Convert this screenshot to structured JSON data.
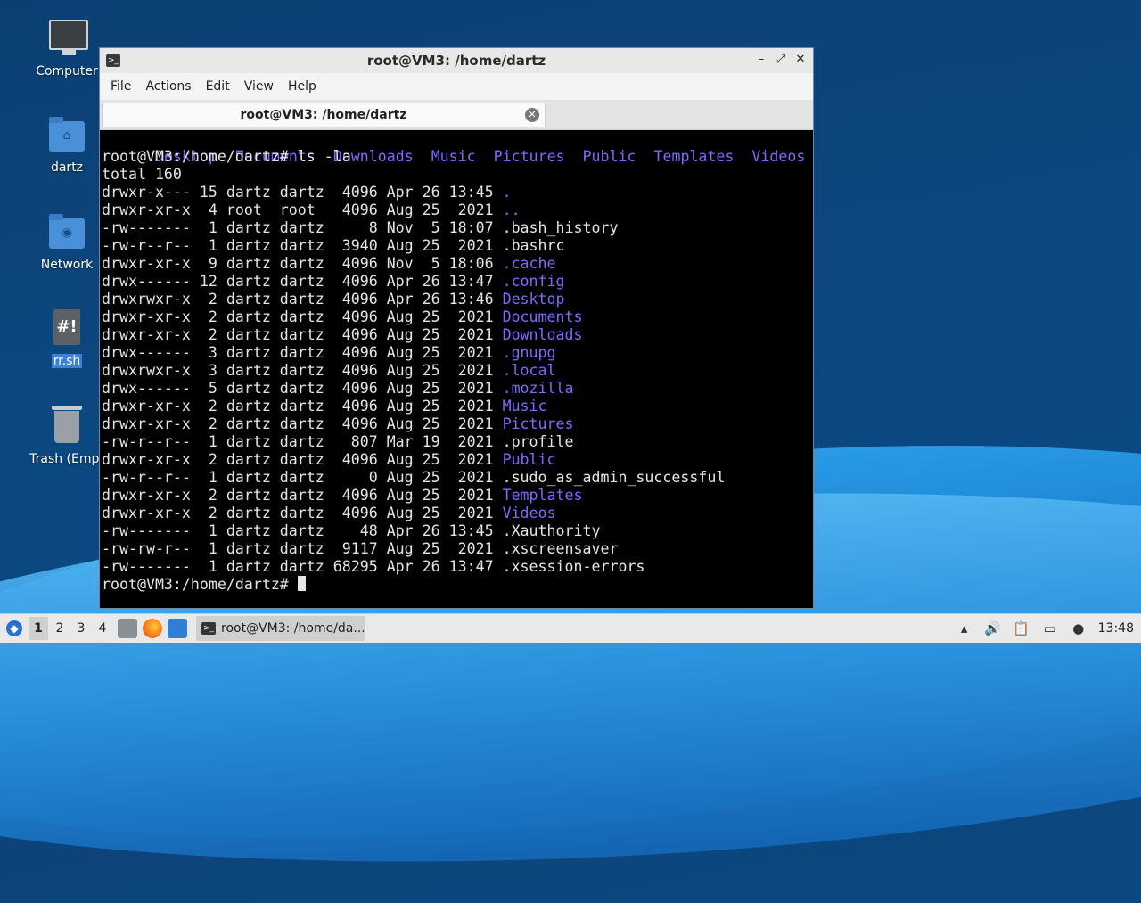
{
  "desktop": {
    "icons": [
      {
        "label": "Computer",
        "icon": "computer-icon"
      },
      {
        "label": "dartz",
        "icon": "home-folder-icon"
      },
      {
        "label": "Network",
        "icon": "network-folder-icon"
      },
      {
        "label": "rr.sh",
        "icon": "shell-script-icon"
      },
      {
        "label": "Trash (Empt",
        "icon": "trash-icon"
      }
    ],
    "script_glyph": "#!"
  },
  "window": {
    "title": "root@VM3: /home/dartz",
    "menu": [
      "File",
      "Actions",
      "Edit",
      "View",
      "Help"
    ],
    "tab_label": "root@VM3: /home/dartz"
  },
  "terminal": {
    "dirs_line": [
      "Desktop",
      "Documents",
      "Downloads",
      "Music",
      "Pictures",
      "Public",
      "Templates",
      "Videos"
    ],
    "prompt": "root@VM3:/home/dartz#",
    "command": " ls -la",
    "total": "total 160",
    "entries": [
      {
        "meta": "drwxr-x--- 15 dartz dartz  4096 Apr 26 13:45 ",
        "name": ".",
        "dir": true
      },
      {
        "meta": "drwxr-xr-x  4 root  root   4096 Aug 25  2021 ",
        "name": "..",
        "dir": true
      },
      {
        "meta": "-rw-------  1 dartz dartz     8 Nov  5 18:07 ",
        "name": ".bash_history",
        "dir": false
      },
      {
        "meta": "-rw-r--r--  1 dartz dartz  3940 Aug 25  2021 ",
        "name": ".bashrc",
        "dir": false
      },
      {
        "meta": "drwxr-xr-x  9 dartz dartz  4096 Nov  5 18:06 ",
        "name": ".cache",
        "dir": true
      },
      {
        "meta": "drwx------ 12 dartz dartz  4096 Apr 26 13:47 ",
        "name": ".config",
        "dir": true
      },
      {
        "meta": "drwxrwxr-x  2 dartz dartz  4096 Apr 26 13:46 ",
        "name": "Desktop",
        "dir": true
      },
      {
        "meta": "drwxr-xr-x  2 dartz dartz  4096 Aug 25  2021 ",
        "name": "Documents",
        "dir": true
      },
      {
        "meta": "drwxr-xr-x  2 dartz dartz  4096 Aug 25  2021 ",
        "name": "Downloads",
        "dir": true
      },
      {
        "meta": "drwx------  3 dartz dartz  4096 Aug 25  2021 ",
        "name": ".gnupg",
        "dir": true
      },
      {
        "meta": "drwxrwxr-x  3 dartz dartz  4096 Aug 25  2021 ",
        "name": ".local",
        "dir": true
      },
      {
        "meta": "drwx------  5 dartz dartz  4096 Aug 25  2021 ",
        "name": ".mozilla",
        "dir": true
      },
      {
        "meta": "drwxr-xr-x  2 dartz dartz  4096 Aug 25  2021 ",
        "name": "Music",
        "dir": true
      },
      {
        "meta": "drwxr-xr-x  2 dartz dartz  4096 Aug 25  2021 ",
        "name": "Pictures",
        "dir": true
      },
      {
        "meta": "-rw-r--r--  1 dartz dartz   807 Mar 19  2021 ",
        "name": ".profile",
        "dir": false
      },
      {
        "meta": "drwxr-xr-x  2 dartz dartz  4096 Aug 25  2021 ",
        "name": "Public",
        "dir": true
      },
      {
        "meta": "-rw-r--r--  1 dartz dartz     0 Aug 25  2021 ",
        "name": ".sudo_as_admin_successful",
        "dir": false
      },
      {
        "meta": "drwxr-xr-x  2 dartz dartz  4096 Aug 25  2021 ",
        "name": "Templates",
        "dir": true
      },
      {
        "meta": "drwxr-xr-x  2 dartz dartz  4096 Aug 25  2021 ",
        "name": "Videos",
        "dir": true
      },
      {
        "meta": "-rw-------  1 dartz dartz    48 Apr 26 13:45 ",
        "name": ".Xauthority",
        "dir": false
      },
      {
        "meta": "-rw-rw-r--  1 dartz dartz  9117 Aug 25  2021 ",
        "name": ".xscreensaver",
        "dir": false
      },
      {
        "meta": "-rw-------  1 dartz dartz 68295 Apr 26 13:47 ",
        "name": ".xsession-errors",
        "dir": false
      }
    ],
    "colors": {
      "directory": "#7b6cff",
      "text": "#e5e5e5",
      "background": "#000000"
    }
  },
  "taskbar": {
    "workspaces": [
      "1",
      "2",
      "3",
      "4"
    ],
    "active_workspace": "1",
    "launchers": [
      "file-manager-icon",
      "firefox-icon",
      "desktop-icon"
    ],
    "task_label": "root@VM3: /home/da...",
    "tray": [
      "tray-arrow-icon",
      "volume-icon",
      "clipboard-icon",
      "display-icon",
      "notification-icon"
    ],
    "clock": "13:48"
  }
}
